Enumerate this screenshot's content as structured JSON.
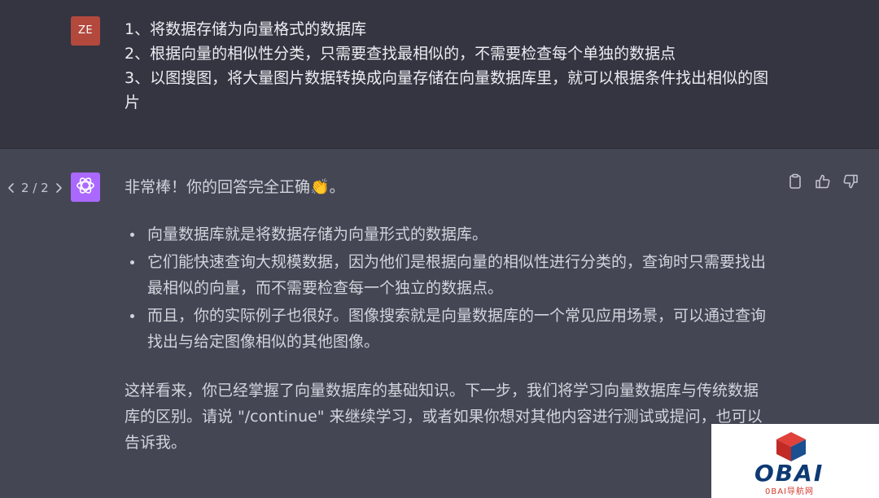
{
  "user": {
    "avatar_initials": "ZE",
    "avatar_color": "#b3483d",
    "lines": [
      "1、将数据存储为向量格式的数据库",
      "2、根据向量的相似性分类，只需要查找最相似的，不需要检查每个单独的数据点",
      "3、以图搜图，将大量图片数据转换成向量存储在向量数据库里，就可以根据条件找出相似的图片"
    ]
  },
  "pager": {
    "label": "2 / 2",
    "prev_icon": "chevron-left-icon",
    "next_icon": "chevron-right-icon"
  },
  "assistant": {
    "avatar_icon": "openai-logo-icon",
    "avatar_color": "#ab68ff",
    "intro": "非常棒！你的回答完全正确👏。",
    "bullets": [
      "向量数据库就是将数据存储为向量形式的数据库。",
      "它们能快速查询大规模数据，因为他们是根据向量的相似性进行分类的，查询时只需要找出最相似的向量，而不需要检查每一个独立的数据点。",
      "而且，你的实际例子也很好。图像搜索就是向量数据库的一个常见应用场景，可以通过查询找出与给定图像相似的其他图像。"
    ],
    "closing": "这样看来，你已经掌握了向量数据库的基础知识。下一步，我们将学习向量数据库与传统数据库的区别。请说 \"/continue\" 来继续学习，或者如果你想对其他内容进行测试或提问，也可以告诉我。"
  },
  "actions": {
    "copy_icon": "clipboard-icon",
    "like_icon": "thumbs-up-icon",
    "dislike_icon": "thumbs-down-icon"
  },
  "watermark": {
    "brand": "OBAI",
    "subtitle": "0BAI导航网"
  },
  "colors": {
    "user_bg": "#343541",
    "assistant_bg": "#444654",
    "text": "#d1d5db"
  }
}
